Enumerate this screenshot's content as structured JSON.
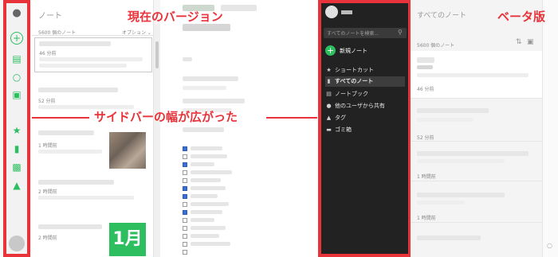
{
  "labels": {
    "current_version": "現在のバージョン",
    "beta_version": "ベータ版",
    "sidebar_wider": "サイドバーの幅が広がった"
  },
  "old_app": {
    "list_title": "ノート",
    "note_count": "5600 個のノート",
    "options_label": "オプション",
    "notes": [
      {
        "time": "46 分前"
      },
      {
        "time": "52 分前"
      },
      {
        "time": "1 時間前"
      },
      {
        "time": "2 時間前"
      },
      {
        "time": "2 時間前"
      }
    ],
    "calendar_text": "1月"
  },
  "beta_app": {
    "search_placeholder": "すべてのノートを検索...",
    "new_note": "新規ノート",
    "sidebar_items": [
      {
        "label": "ショートカット",
        "icon": "star-icon"
      },
      {
        "label": "すべてのノート",
        "icon": "note-icon",
        "selected": true
      },
      {
        "label": "ノートブック",
        "icon": "notebook-icon"
      },
      {
        "label": "他のユーザから共有",
        "icon": "people-icon"
      },
      {
        "label": "タグ",
        "icon": "tag-icon"
      },
      {
        "label": "ゴミ箱",
        "icon": "trash-icon"
      }
    ],
    "list_title": "すべてのノート",
    "note_count": "5600 個のノート",
    "notes": [
      {
        "time": "46 分前"
      },
      {
        "time": "52 分前"
      },
      {
        "time": "1 時間前"
      },
      {
        "time": "1 時間前"
      }
    ]
  },
  "colors": {
    "accent_red": "#e8333a",
    "evernote_green": "#2dbe60",
    "beta_sidebar": "#222222"
  }
}
